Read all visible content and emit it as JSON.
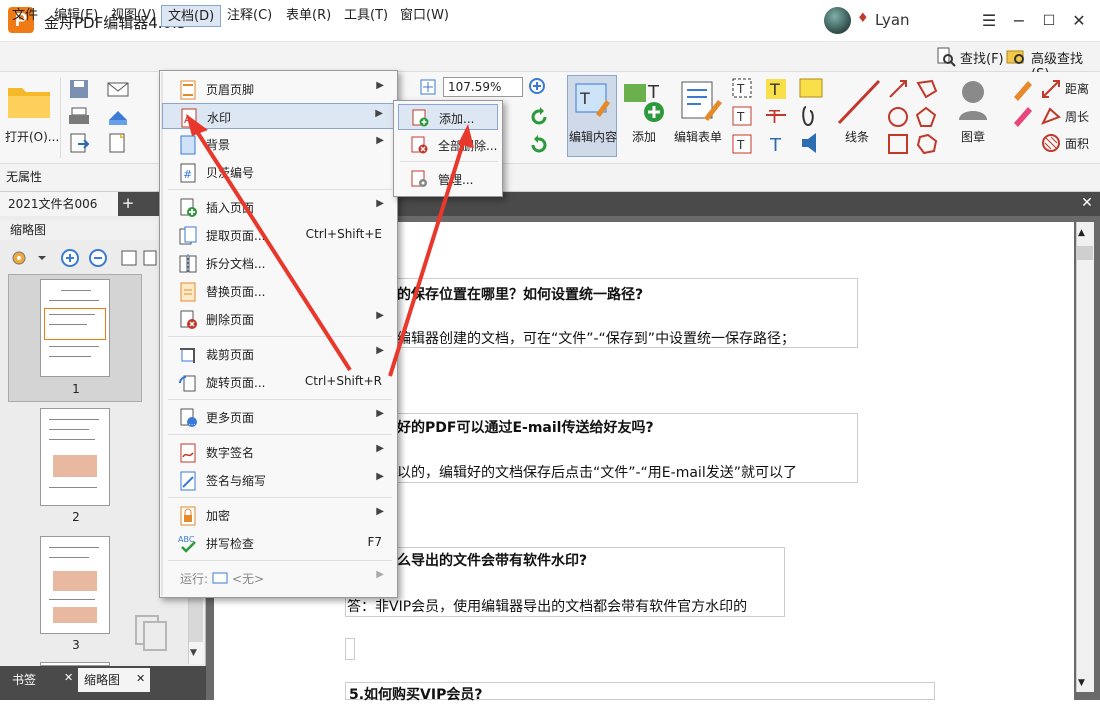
{
  "app": {
    "title": "金舟PDF编辑器4.0.3",
    "logo": "P",
    "user": "Lyan"
  },
  "window": {
    "minimize": "−",
    "maximize": "☐",
    "close": "✕",
    "menu": "☰"
  },
  "menubar": {
    "items": [
      "文件",
      "编辑(E)",
      "视图(V)",
      "文档(D)",
      "注释(C)",
      "表单(R)",
      "工具(T)",
      "窗口(W)"
    ],
    "find": "查找(F)",
    "advanced_find": "高级查找(S)"
  },
  "ribbon": {
    "open": "打开(O)...",
    "zoom": "107.59%",
    "edit_content": "编辑内容",
    "add": "添加",
    "edit_form": "编辑表单",
    "lines": "线条",
    "stamp": "图章",
    "distance": "距离",
    "perimeter": "周长",
    "area": "面积"
  },
  "props": {
    "label": "无属性"
  },
  "tabs": {
    "document": "2021文件名006",
    "add": "+",
    "close": "✕"
  },
  "left_panel": {
    "header": "缩略图",
    "thumbnails": [
      "1",
      "2",
      "3"
    ],
    "tab_bookmarks": "书签",
    "tab_thumbnails": "缩略图",
    "tab_close": "✕"
  },
  "document": {
    "q1": "的保存位置在哪里？如何设置统一路径?",
    "a1": "编辑器创建的文档，可在“文件”-“保存到”中设置统一保存路径；",
    "q2": "好的PDF可以通过E-mail传送给好友吗?",
    "a2": "以的，编辑好的文档保存后点击“文件”-“用E-mail发送”就可以了",
    "q3": "么导出的文件会带有软件水印?",
    "a3": "答：非VIP会员，使用编辑器导出的文档都会带有软件官方水印的",
    "q4": "5.如何购买VIP会员?"
  },
  "dropdown": {
    "items": [
      {
        "label": "页眉页脚",
        "shortcut": "",
        "submenu": true
      },
      {
        "label": "水印",
        "shortcut": "",
        "submenu": true
      },
      {
        "label": "背景",
        "shortcut": "",
        "submenu": true
      },
      {
        "label": "贝茨编号",
        "shortcut": "",
        "submenu": true
      },
      {
        "label": "插入页面",
        "shortcut": "",
        "submenu": true
      },
      {
        "label": "提取页面...",
        "shortcut": "Ctrl+Shift+E",
        "submenu": false
      },
      {
        "label": "拆分文档...",
        "shortcut": "",
        "submenu": false
      },
      {
        "label": "替换页面...",
        "shortcut": "",
        "submenu": false
      },
      {
        "label": "删除页面",
        "shortcut": "",
        "submenu": true
      },
      {
        "label": "裁剪页面",
        "shortcut": "",
        "submenu": true
      },
      {
        "label": "旋转页面...",
        "shortcut": "Ctrl+Shift+R",
        "submenu": false
      },
      {
        "label": "更多页面",
        "shortcut": "",
        "submenu": true
      },
      {
        "label": "数字签名",
        "shortcut": "",
        "submenu": true
      },
      {
        "label": "签名与缩写",
        "shortcut": "",
        "submenu": true
      },
      {
        "label": "加密",
        "shortcut": "",
        "submenu": true
      },
      {
        "label": "拼写检查",
        "shortcut": "F7",
        "submenu": false
      },
      {
        "label": "运行:",
        "shortcut": "",
        "submenu": true
      }
    ],
    "run_value": "<无>",
    "arrow": "▶"
  },
  "submenu": {
    "add": "添加...",
    "remove_all": "全部删除...",
    "manage": "管理..."
  },
  "colors": {
    "accent": "#f07b14",
    "highlight": "#dde6f3",
    "arrow": "#e8372b"
  }
}
